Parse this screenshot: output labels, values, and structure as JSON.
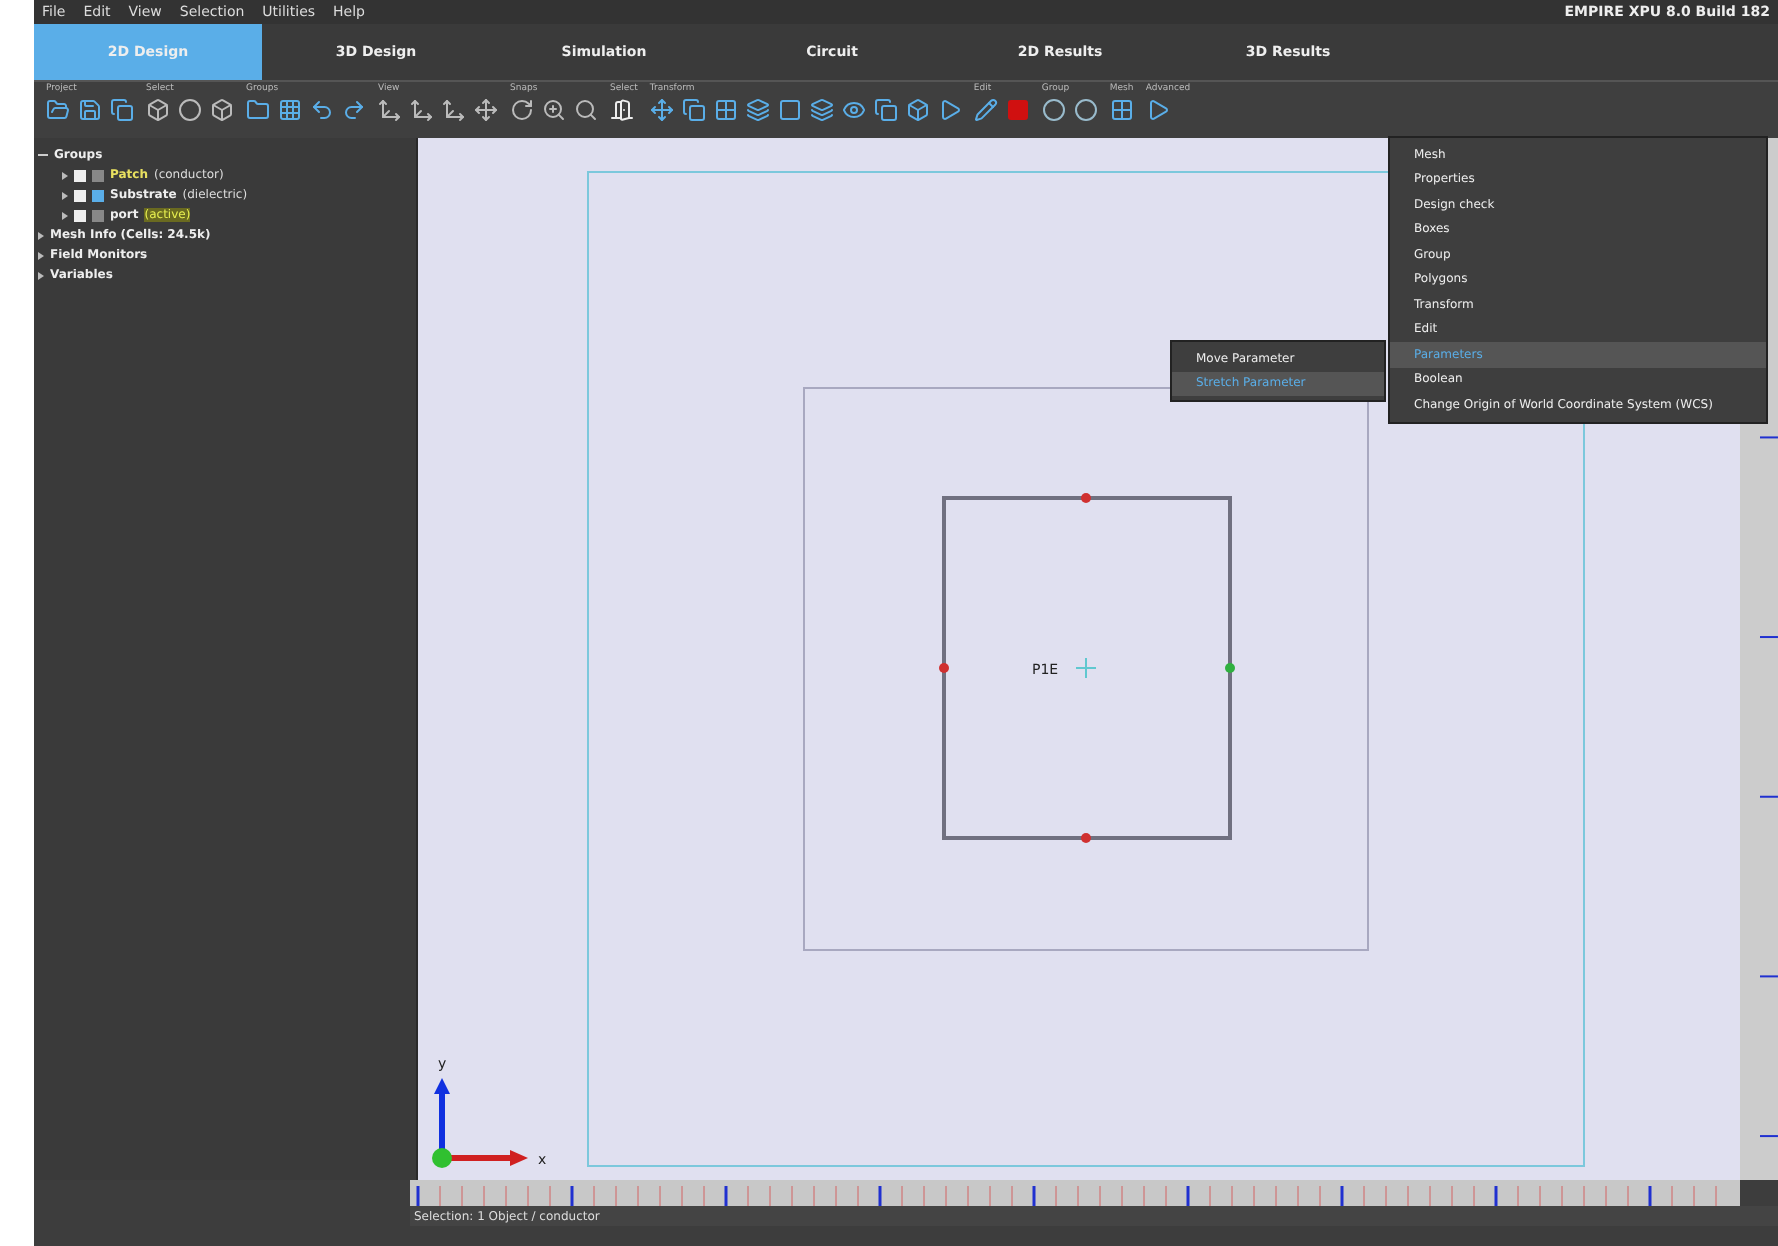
{
  "menu_bar": [
    "File",
    "Edit",
    "View",
    "Selection",
    "Utilities",
    "Help"
  ],
  "app_title": "EMPIRE XPU 8.0 Build 182",
  "tabs": [
    {
      "label": "2D Design",
      "selected": true
    },
    {
      "label": "3D Design",
      "selected": false
    },
    {
      "label": "Simulation",
      "selected": false
    },
    {
      "label": "Circuit",
      "selected": false
    },
    {
      "label": "2D Results",
      "selected": false
    },
    {
      "label": "3D Results",
      "selected": false
    }
  ],
  "toolbar_groups": [
    {
      "label": "Project"
    },
    {
      "label": "Select"
    },
    {
      "label": "Groups"
    },
    {
      "label": "View"
    },
    {
      "label": "Snaps"
    },
    {
      "label": "Select"
    },
    {
      "label": "Transform"
    },
    {
      "label": "Edit"
    },
    {
      "label": "Group"
    },
    {
      "label": "Mesh"
    },
    {
      "label": "Advanced"
    }
  ],
  "tree": [
    {
      "name": "Groups",
      "expanded": true,
      "children": [
        {
          "name": "Patch",
          "detail": "(conductor)",
          "selected": true,
          "active": false
        },
        {
          "name": "Substrate",
          "detail": "(dielectric)",
          "selected": false,
          "active": false
        },
        {
          "name": "port",
          "detail": "(active)",
          "selected": false,
          "active": true
        }
      ]
    },
    {
      "name": "Mesh Info (Cells: 24.5k)",
      "expanded": false
    },
    {
      "name": "Field Monitors",
      "expanded": false
    },
    {
      "name": "Variables",
      "expanded": false
    }
  ],
  "canvas": {
    "object_label": "P1E",
    "axis_y": "y",
    "axis_x": "x"
  },
  "context_menu": [
    {
      "label": "Mesh",
      "selected": false
    },
    {
      "label": "Properties",
      "selected": false
    },
    {
      "label": "Design check",
      "selected": false
    },
    {
      "label": "Boxes",
      "selected": false
    },
    {
      "label": "Group",
      "selected": false
    },
    {
      "label": "Polygons",
      "selected": false
    },
    {
      "label": "Transform",
      "selected": false
    },
    {
      "label": "Edit",
      "selected": false
    },
    {
      "label": "Parameters",
      "selected": true
    },
    {
      "label": "Boolean",
      "selected": false
    },
    {
      "label": "Change Origin of World Coordinate System (WCS)",
      "selected": false
    }
  ],
  "submenu": [
    {
      "label": "Move Parameter",
      "selected": false
    },
    {
      "label": "Stretch Parameter",
      "selected": true
    }
  ],
  "status_bar": "Selection: 1 Object / conductor"
}
